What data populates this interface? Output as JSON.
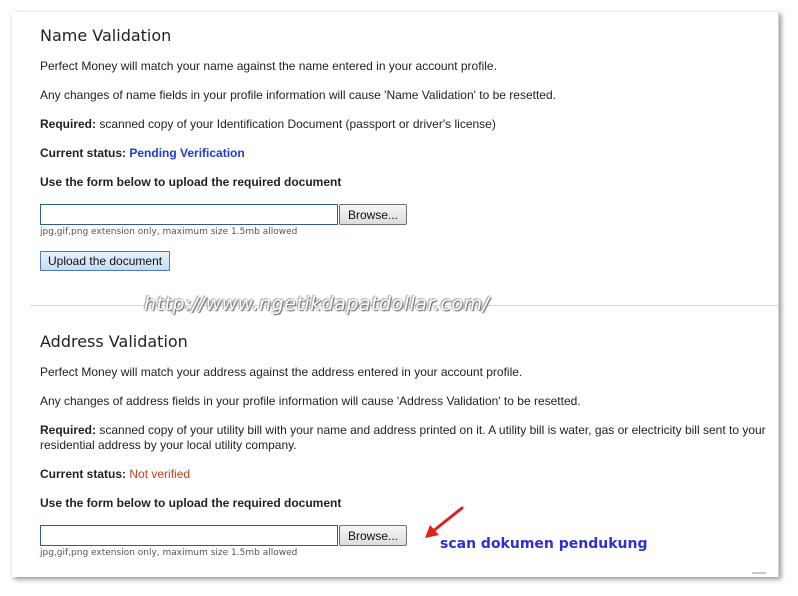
{
  "name_validation": {
    "title": "Name Validation",
    "intro": "Perfect Money will match your name against the name entered in your account profile.",
    "changes_note": "Any changes of name fields in your profile information will cause 'Name Validation' to be resetted.",
    "required_label": "Required:",
    "required_text": " scanned copy of your Identification Document (passport or driver's license)",
    "status_label": "Current status:",
    "status_value": "Pending Verification",
    "status_color": "#1d3bd6",
    "upload_instruction": "Use the form below to upload the required document",
    "browse_label": "Browse...",
    "file_hint": "jpg,gif,png extension only, maximum size 1.5mb allowed",
    "upload_button": "Upload the document"
  },
  "watermark": "http://www.ngetikdapatdollar.com/",
  "address_validation": {
    "title": "Address Validation",
    "intro": "Perfect Money will match your address against the address entered in your account profile.",
    "changes_note": "Any changes of address fields in your profile information will cause 'Address Validation' to be resetted.",
    "required_label": "Required:",
    "required_text": " scanned copy of your utility bill with your name and address printed on it. A utility bill is water, gas or electricity bill sent to your residential address by your local utility company.",
    "status_label": "Current status:",
    "status_value": "Not verified",
    "status_color": "#c0441a",
    "upload_instruction": "Use the form below to upload the required document",
    "browse_label": "Browse...",
    "file_hint": "jpg,gif,png extension only, maximum size 1.5mb allowed"
  },
  "annotation": {
    "text": "scan dokumen pendukung",
    "arrow_color": "#e02020"
  }
}
